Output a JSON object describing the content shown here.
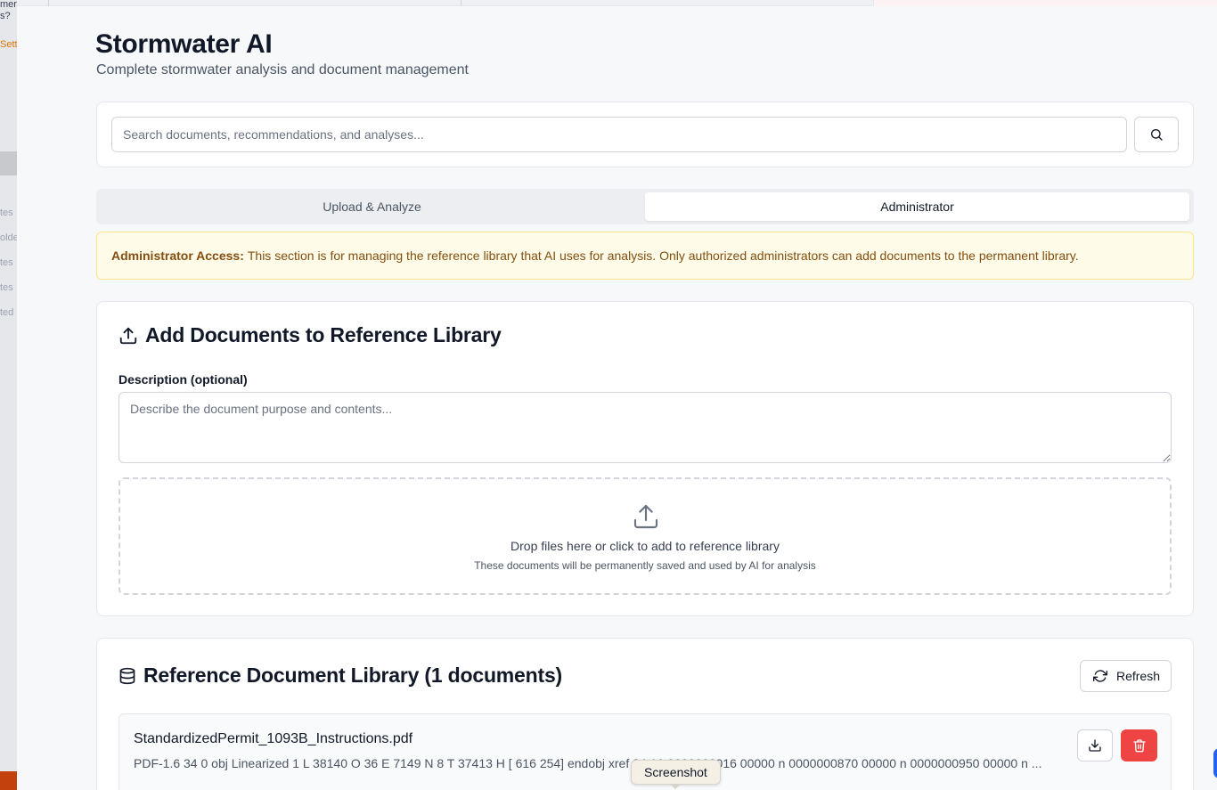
{
  "background_app": {
    "snippets": [
      "mer",
      "s?",
      "Sett",
      "tes",
      "olde",
      "tes",
      "tes",
      "ted"
    ]
  },
  "header": {
    "title": "Stormwater AI",
    "subtitle": "Complete stormwater analysis and document management"
  },
  "search": {
    "placeholder": "Search documents, recommendations, and analyses...",
    "value": "",
    "button_icon": "search-icon"
  },
  "tabs": [
    {
      "label": "Upload & Analyze",
      "active": false
    },
    {
      "label": "Administrator",
      "active": true
    }
  ],
  "notice": {
    "bold": "Administrator Access:",
    "text": "This section is for managing the reference library that AI uses for analysis. Only authorized administrators can add documents to the permanent library."
  },
  "add_section": {
    "icon": "upload-icon",
    "title": "Add Documents to Reference Library",
    "description_label": "Description (optional)",
    "description_placeholder": "Describe the document purpose and contents...",
    "dropzone_main": "Drop files here or click to add to reference library",
    "dropzone_sub": "These documents will be permanently saved and used by AI for analysis"
  },
  "library": {
    "icon": "database-icon",
    "title": "Reference Document Library (1 documents)",
    "refresh_label": "Refresh",
    "documents": [
      {
        "name": "StandardizedPermit_1093B_Instructions.pdf",
        "preview": "PDF-1.6 34 0 obj Linearized 1 L 38140 O 36 E 7149 N 8 T 37413 H [ 616 254] endobj xref 34 16 0000000016 00000 n 0000000870 00000 n 0000000950 00000 n ..."
      }
    ]
  },
  "tooltip": {
    "text": "Screenshot"
  },
  "colors": {
    "danger": "#ef4444",
    "notice_bg": "#fefce8",
    "notice_text": "#854d0e"
  }
}
